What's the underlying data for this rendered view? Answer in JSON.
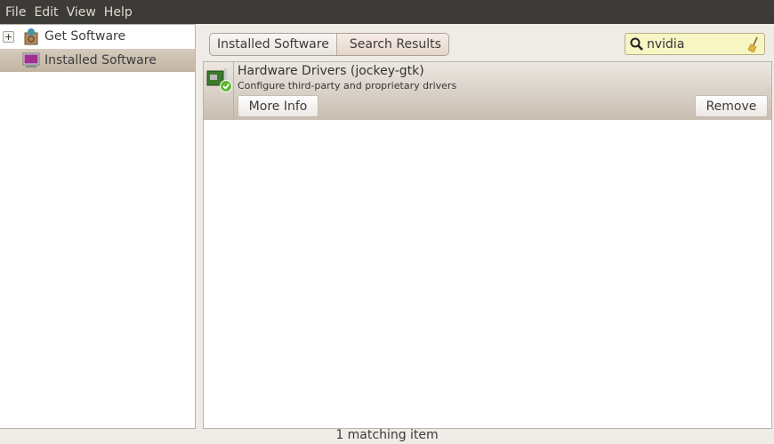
{
  "menubar": {
    "items": [
      "File",
      "Edit",
      "View",
      "Help"
    ]
  },
  "sidebar": {
    "items": [
      {
        "label": "Get Software",
        "icon": "ubuntu-box-icon"
      },
      {
        "label": "Installed Software",
        "icon": "monitor-icon",
        "selected": true
      }
    ]
  },
  "breadcrumb": [
    "Installed Software",
    "Search Results"
  ],
  "search": {
    "value": "nvidia"
  },
  "results": [
    {
      "title": "Hardware Drivers (jockey-gtk)",
      "subtitle": "Configure third-party and proprietary drivers",
      "more_info": "More Info",
      "remove": "Remove"
    }
  ],
  "status": "1 matching item"
}
